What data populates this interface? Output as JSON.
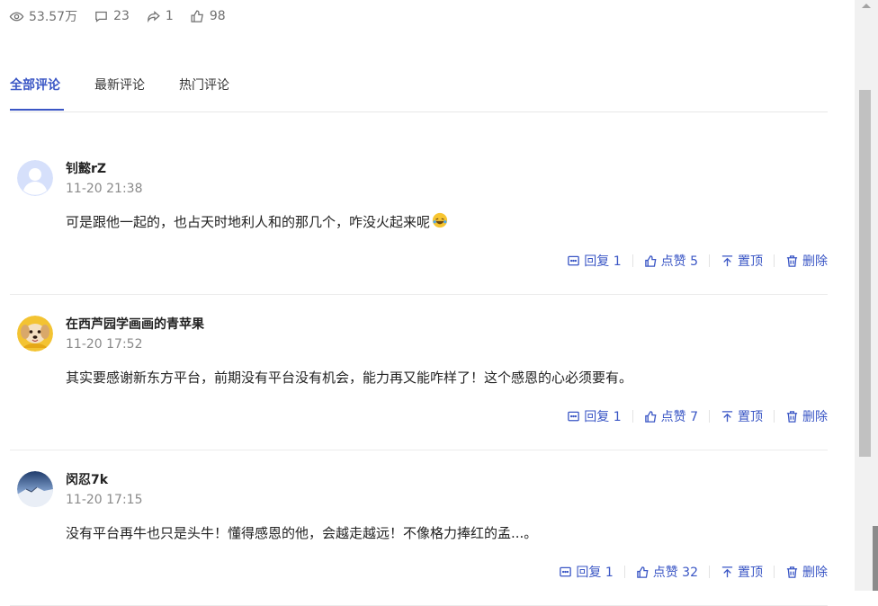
{
  "stats": {
    "views": "53.57万",
    "comments": "23",
    "shares": "1",
    "likes": "98"
  },
  "tabs": [
    {
      "label": "全部评论",
      "active": true
    },
    {
      "label": "最新评论",
      "active": false
    },
    {
      "label": "热门评论",
      "active": false
    }
  ],
  "comments": [
    {
      "username": "钊懿rZ",
      "time": "11-20 21:38",
      "text": "可是跟他一起的，也占天时地利人和的那几个，咋没火起来呢",
      "emoji": "laughing-tears-emoji",
      "reply": "回复 1",
      "like": "点赞 5",
      "pin": "置顶",
      "delete": "删除"
    },
    {
      "username": "在西芦园学画画的青苹果",
      "time": "11-20 17:52",
      "text": "其实要感谢新东方平台，前期没有平台没有机会，能力再又能咋样了！这个感恩的心必须要有。",
      "reply": "回复 1",
      "like": "点赞 7",
      "pin": "置顶",
      "delete": "删除"
    },
    {
      "username": "闵忍7k",
      "time": "11-20 17:15",
      "text": "没有平台再牛也只是头牛！懂得感恩的他，会越走越远！不像格力捧红的孟...。",
      "reply": "回复 1",
      "like": "点赞 32",
      "pin": "置顶",
      "delete": "删除"
    }
  ],
  "colors": {
    "accent": "#3a56c5",
    "meta": "#8a8a8a",
    "stats": "#707070"
  }
}
